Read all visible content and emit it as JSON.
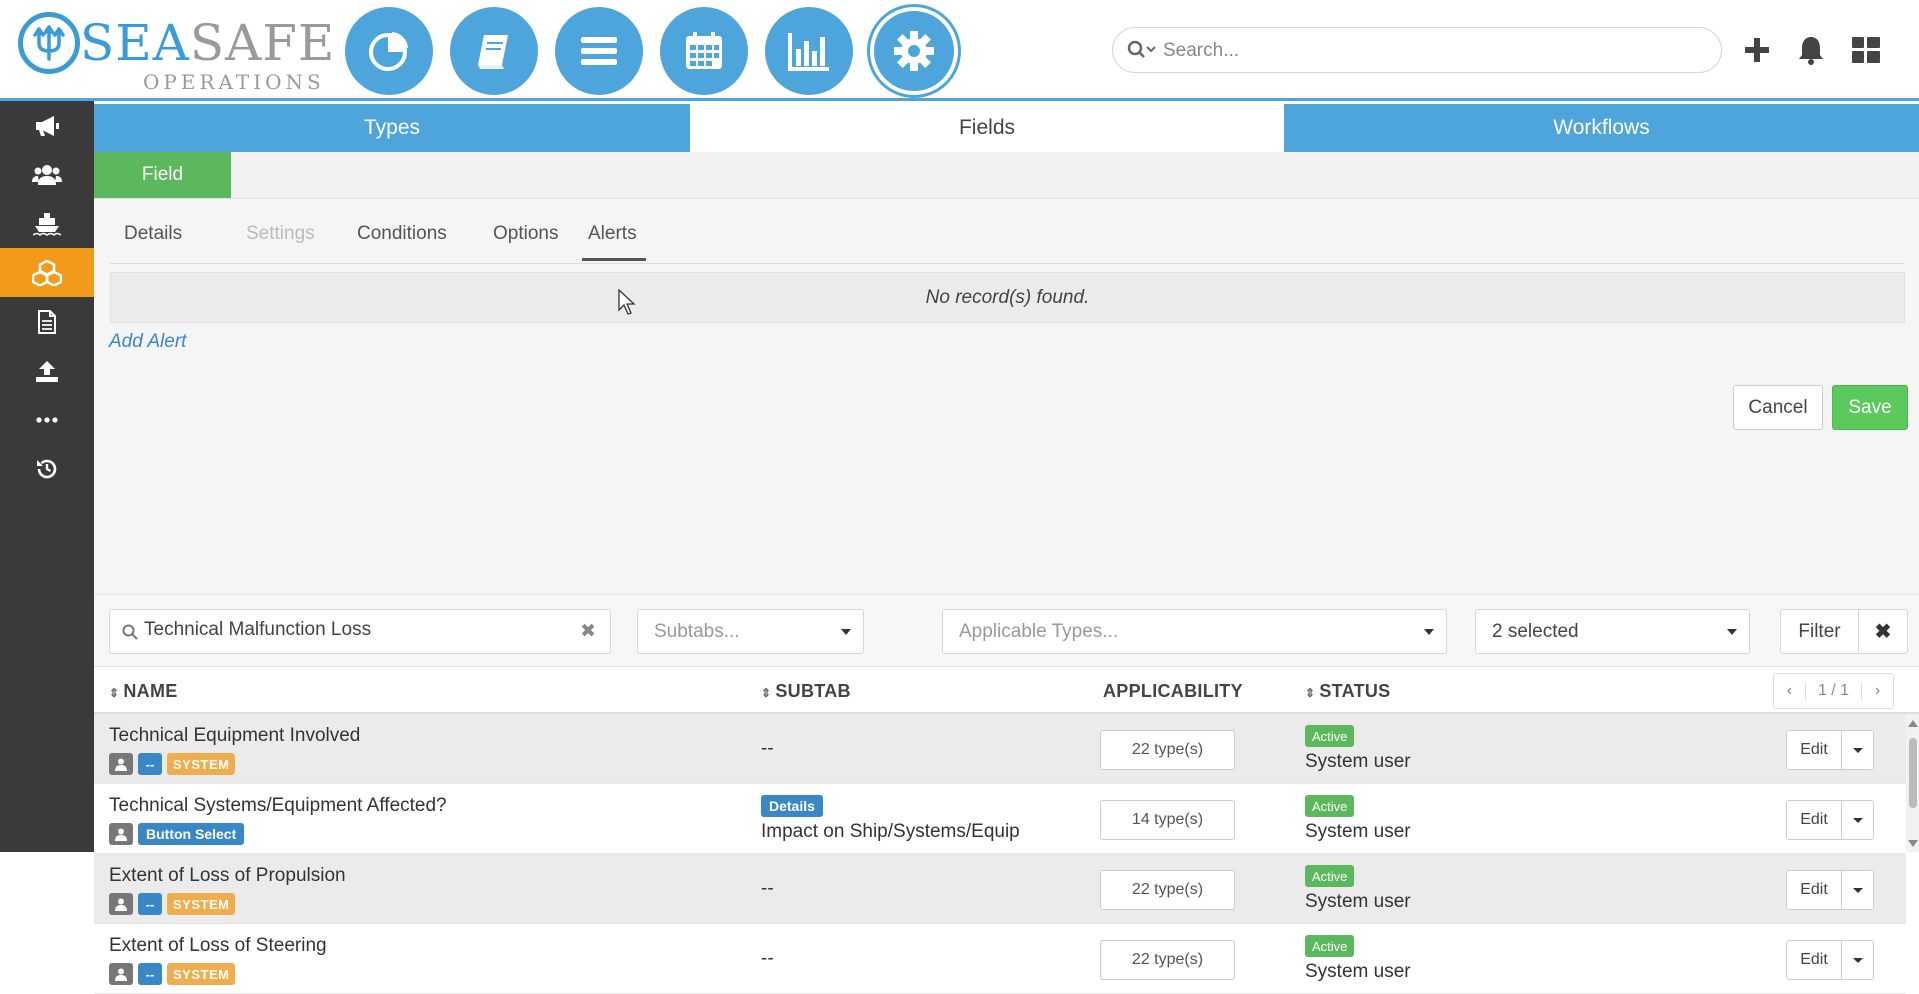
{
  "brand": {
    "name_part1": "SEA",
    "name_part2": "SAFE",
    "subtitle": "OPERATIONS"
  },
  "top_nav": [
    {
      "icon": "pie-chart-icon",
      "active": false
    },
    {
      "icon": "book-icon",
      "active": false
    },
    {
      "icon": "list-icon",
      "active": false
    },
    {
      "icon": "calendar-icon",
      "active": false
    },
    {
      "icon": "bar-chart-icon",
      "active": false
    },
    {
      "icon": "gear-icon",
      "active": true
    }
  ],
  "search": {
    "placeholder": "Search..."
  },
  "top_actions": [
    "plus-icon",
    "bell-icon",
    "apps-grid-icon"
  ],
  "sidebar": {
    "items": [
      {
        "icon": "megaphone-icon",
        "active": false
      },
      {
        "icon": "users-icon",
        "active": false
      },
      {
        "icon": "ship-icon",
        "active": false
      },
      {
        "icon": "cubes-icon",
        "active": true
      },
      {
        "icon": "document-icon",
        "active": false
      },
      {
        "icon": "upload-icon",
        "active": false
      },
      {
        "icon": "more-icon",
        "active": false
      },
      {
        "icon": "history-icon",
        "active": false
      }
    ]
  },
  "main_tabs": [
    {
      "label": "Types",
      "active": false
    },
    {
      "label": "Fields",
      "active": true
    },
    {
      "label": "Workflows",
      "active": false
    }
  ],
  "field_button": "Field",
  "subtabs": [
    {
      "label": "Details",
      "state": "normal"
    },
    {
      "label": "Settings",
      "state": "disabled"
    },
    {
      "label": "Conditions",
      "state": "normal"
    },
    {
      "label": "Options",
      "state": "normal"
    },
    {
      "label": "Alerts",
      "state": "active"
    }
  ],
  "alerts": {
    "empty_message": "No record(s) found.",
    "add_link": "Add Alert"
  },
  "form_actions": {
    "cancel": "Cancel",
    "save": "Save"
  },
  "filters": {
    "search_value": "Technical Malfunction Loss",
    "subtabs_placeholder": "Subtabs...",
    "types_placeholder": "Applicable Types...",
    "status_value": "2 selected",
    "filter_label": "Filter",
    "clear_symbol": "✖"
  },
  "table": {
    "headers": {
      "name": "NAME",
      "subtab": "SUBTAB",
      "applicability": "APPLICABILITY",
      "status": "STATUS"
    },
    "pager": {
      "prev": "‹",
      "page": "1 / 1",
      "next": "›"
    },
    "rows": [
      {
        "name": "Technical Equipment Involved",
        "type_badge": "--",
        "system_badge": "SYSTEM",
        "subtab_badge": "",
        "subtab": "--",
        "types": "22 type(s)",
        "status": "Active",
        "owner": "System user",
        "edit": "Edit"
      },
      {
        "name": "Technical Systems/Equipment Affected?",
        "type_badge": "Button Select",
        "system_badge": "",
        "subtab_badge": "Details",
        "subtab": "Impact on Ship/Systems/Equip",
        "types": "14 type(s)",
        "status": "Active",
        "owner": "System user",
        "edit": "Edit"
      },
      {
        "name": "Extent of Loss of Propulsion",
        "type_badge": "--",
        "system_badge": "SYSTEM",
        "subtab_badge": "",
        "subtab": "--",
        "types": "22 type(s)",
        "status": "Active",
        "owner": "System user",
        "edit": "Edit"
      },
      {
        "name": "Extent of Loss of Steering",
        "type_badge": "--",
        "system_badge": "SYSTEM",
        "subtab_badge": "",
        "subtab": "--",
        "types": "22 type(s)",
        "status": "Active",
        "owner": "System user",
        "edit": "Edit"
      }
    ]
  },
  "colors": {
    "brand_blue": "#4ea5dc",
    "sidebar_bg": "#3a3a3a",
    "sidebar_active": "#f49a1a",
    "success_green": "#5cb85c",
    "system_orange": "#f0ad4e"
  }
}
